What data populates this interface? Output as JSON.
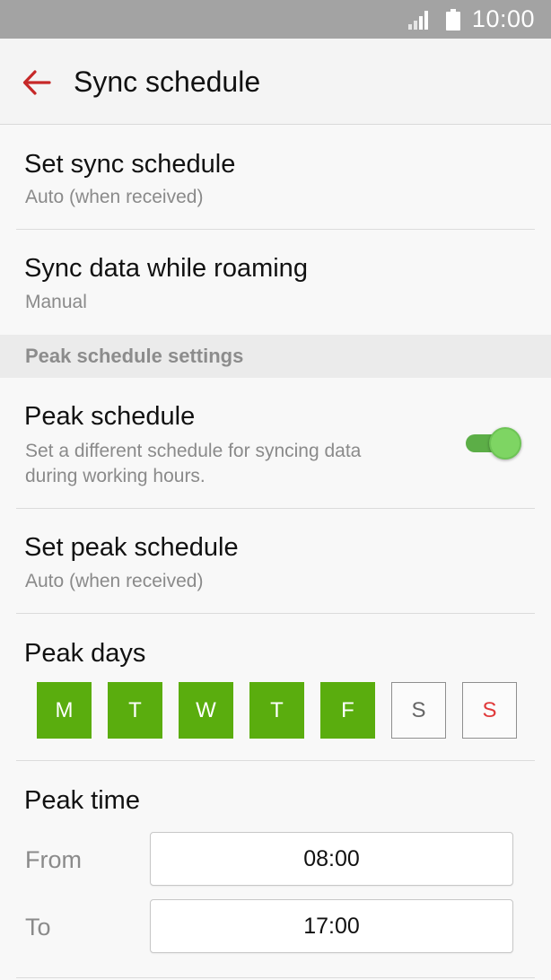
{
  "status_bar": {
    "time": "10:00",
    "signal_icon": "signal-icon",
    "battery_icon": "battery-icon"
  },
  "header": {
    "title": "Sync schedule",
    "back_icon": "back-arrow-icon",
    "back_color": "#c62828"
  },
  "settings": {
    "set_sync_schedule": {
      "title": "Set sync schedule",
      "value": "Auto (when received)"
    },
    "sync_roaming": {
      "title": "Sync data while roaming",
      "value": "Manual"
    }
  },
  "peak_section": {
    "header": "Peak schedule settings",
    "peak_schedule": {
      "title": "Peak schedule",
      "description_line1": "Set a different schedule for syncing data",
      "description_line2": "during working hours.",
      "enabled": true
    },
    "set_peak_schedule": {
      "title": "Set peak schedule",
      "value": "Auto (when received)"
    },
    "peak_days": {
      "title": "Peak days",
      "days": [
        {
          "label": "M",
          "selected": true
        },
        {
          "label": "T",
          "selected": true
        },
        {
          "label": "W",
          "selected": true
        },
        {
          "label": "T",
          "selected": true
        },
        {
          "label": "F",
          "selected": true
        },
        {
          "label": "S",
          "selected": false
        },
        {
          "label": "S",
          "selected": false
        }
      ]
    },
    "peak_time": {
      "title": "Peak time",
      "from_label": "From",
      "from_value": "08:00",
      "to_label": "To",
      "to_value": "17:00"
    }
  },
  "colors": {
    "accent_green": "#5aad0e",
    "toggle_green": "#7ed563",
    "sunday_red": "#e0393a",
    "status_bar": "#a3a3a3"
  }
}
